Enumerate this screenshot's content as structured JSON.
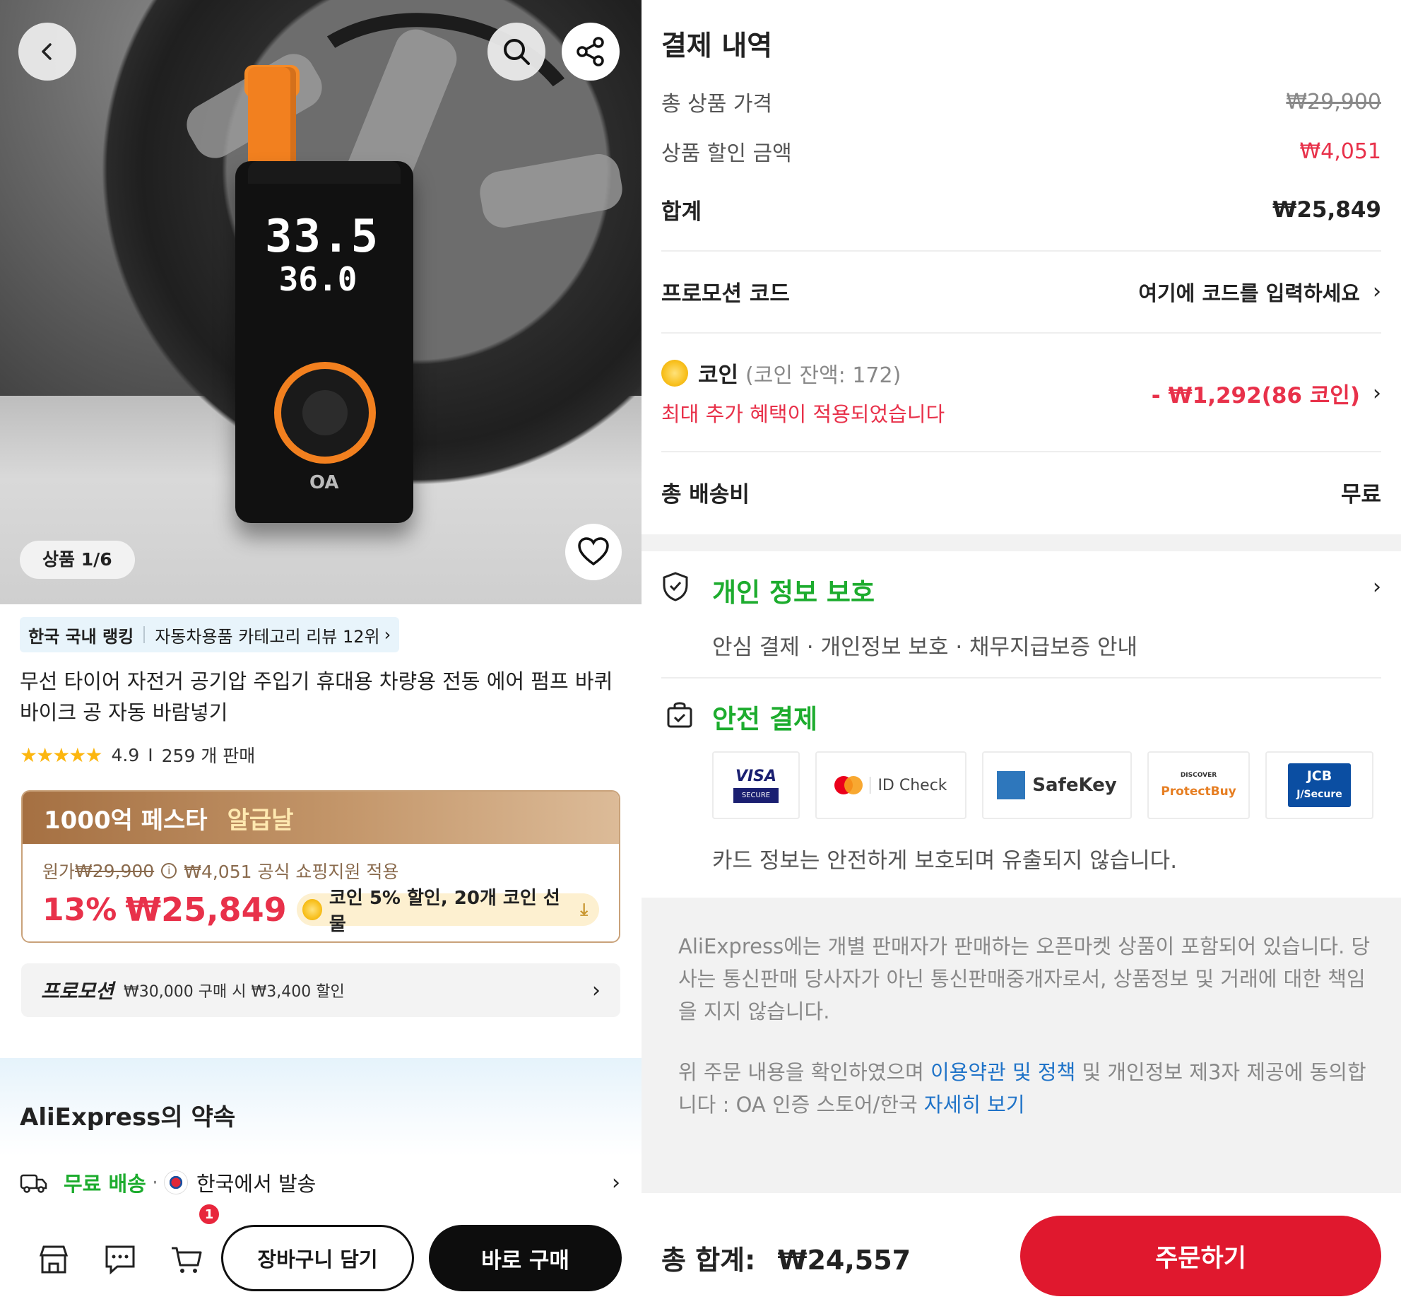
{
  "product": {
    "image_counter": "상품 1/6",
    "device_display": {
      "main": "33.5",
      "target": "36.0"
    },
    "device_logo": "OA",
    "ranking": {
      "label": "한국 국내 랭킹",
      "detail": "자동차용품 카테고리 리뷰 12위"
    },
    "title": "무선 타이어 자전거 공기압 주입기 휴대용 차량용 전동 에어 펌프 바퀴 바이크 공 자동 바람넣기",
    "rating_value": "4.9",
    "rating_stars": 5,
    "sold": "259 개 판매"
  },
  "festa": {
    "headline": "1000억 페스타",
    "tag": "알급날",
    "original_label": "원가",
    "original_price": "₩29,900",
    "discount": "₩4,051 공식 쇼핑지원 적용",
    "percent": "13%",
    "price": "₩25,849",
    "coin_offer": "코인 5% 할인,  20개 코인 선물"
  },
  "promotion": {
    "label": "프로모션",
    "detail": "₩30,000 구매 시 ₩3,400 할인"
  },
  "promise": {
    "title": "AliExpress의 약속",
    "free_shipping": "무료 배송",
    "ship_from": "한국에서 발송"
  },
  "bottom_bar": {
    "cart_count": "1",
    "cart_button": "장바구니 담기",
    "buy_button": "바로 구매"
  },
  "payment": {
    "title": "결제 내역",
    "rows": {
      "subtotal_label": "총 상품 가격",
      "subtotal_value": "₩29,900",
      "discount_label": "상품 할인 금액",
      "discount_value": "₩4,051",
      "sum_label": "합계",
      "sum_value": "₩25,849"
    },
    "promo_code_label": "프로모션 코드",
    "promo_code_placeholder": "여기에 코드를 입력하세요",
    "coin_label": "코인",
    "coin_balance": "(코인 잔액: 172)",
    "coin_note": "최대 추가 혜택이 적용되었습니다",
    "coin_value": "- ₩1,292(86 코인)",
    "shipping_label": "총 배송비",
    "shipping_value": "무료"
  },
  "privacy": {
    "title": "개인 정보 보호",
    "subtitle": "안심 결제 · 개인정보 보호 · 채무지급보증 안내"
  },
  "secure": {
    "title": "안전 결제",
    "logos": [
      "VISA SECURE",
      "ID Check",
      "SafeKey",
      "ProtectBuy",
      "JCB J/Secure"
    ],
    "note": "카드 정보는 안전하게 보호되며 유출되지 않습니다."
  },
  "legal": {
    "p1": "AliExpress에는 개별 판매자가 판매하는 오픈마켓 상품이 포함되어 있습니다. 당사는 통신판매 당사자가 아닌 통신판매중개자로서, 상품정보 및 거래에 대한 책임을 지지 않습니다.",
    "p2_a": "위 주문 내용을 확인하였으며 ",
    "p2_link1": "이용약관 및 정책",
    "p2_b": " 및 개인정보 제3자 제공에 동의합니다 :  OA 인증 스토어/한국 ",
    "p2_link2": "자세히 보기"
  },
  "checkout": {
    "total_label": "총 합계:",
    "total_value": "₩24,557",
    "order_button": "주문하기"
  },
  "colors": {
    "accent_red": "#e0182e",
    "price_red": "#e8314a",
    "green": "#1dac2e",
    "link_blue": "#1f73c8",
    "coin_gold": "#f8c01e"
  }
}
